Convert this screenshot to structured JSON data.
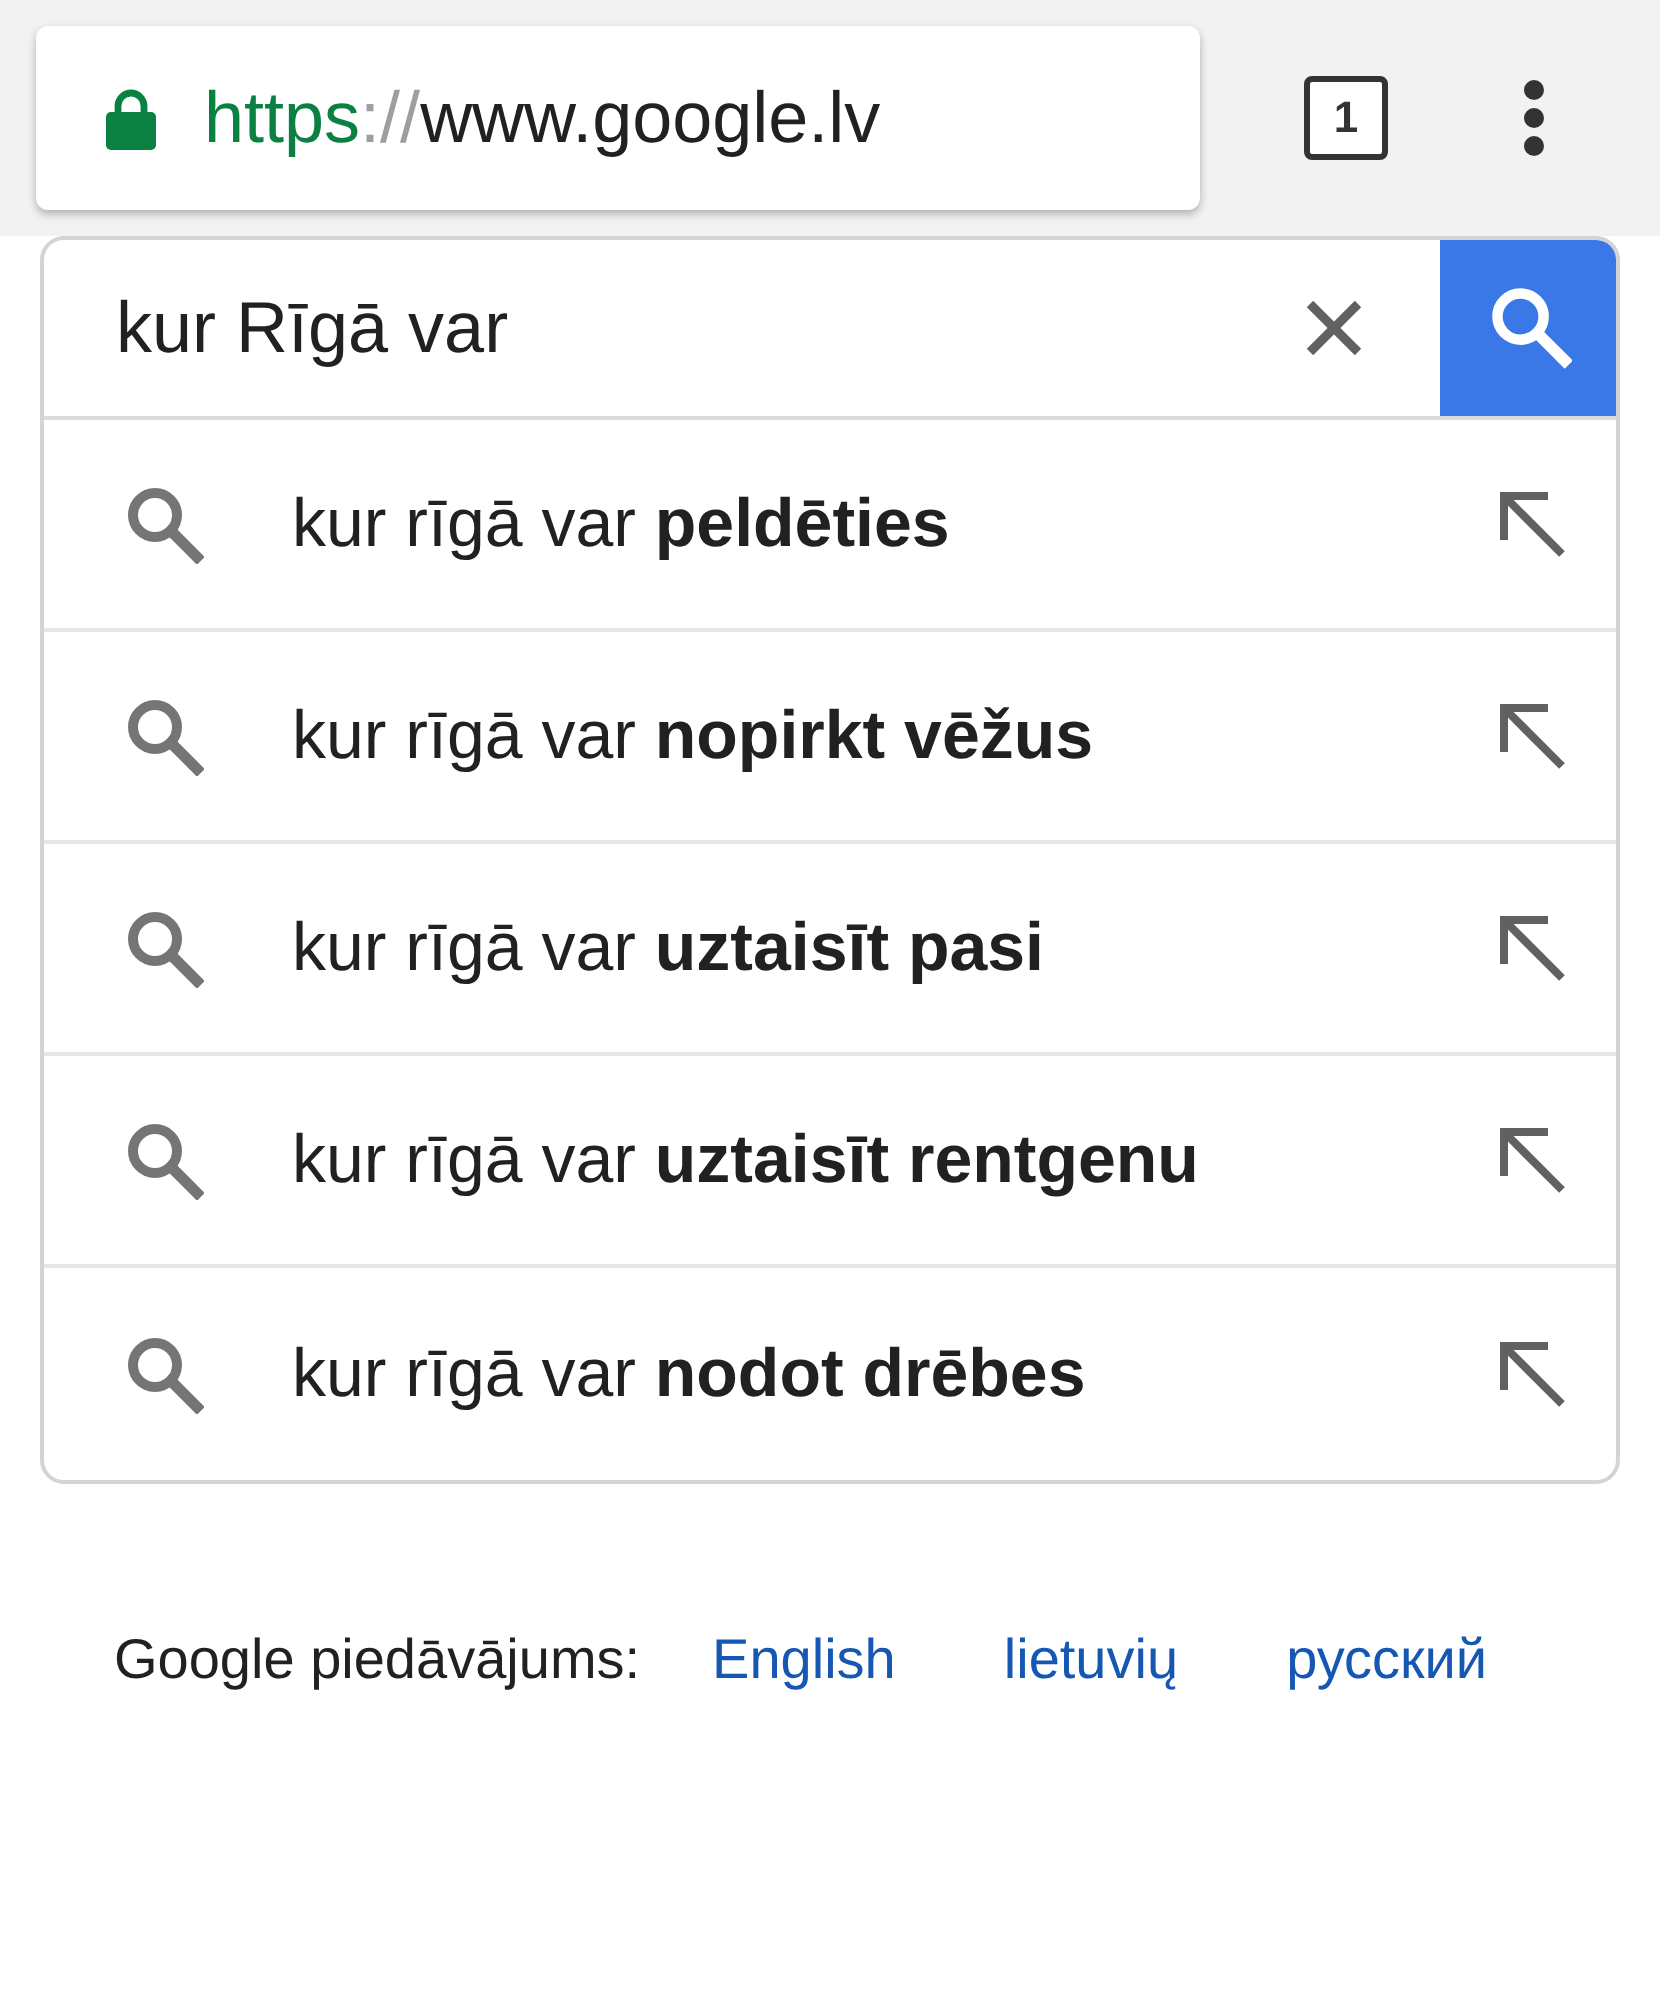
{
  "address_bar": {
    "secure": true,
    "scheme": "https",
    "separator": "://",
    "host": "www.google.lv"
  },
  "tab_count": "1",
  "search": {
    "query": "kur Rīgā var"
  },
  "suggestions": [
    {
      "text": "kur rīgā var **peldēties**"
    },
    {
      "text": "kur rīgā var **nopirkt vēžus**"
    },
    {
      "text": "kur rīgā var **uztaisīt pasi**"
    },
    {
      "text": "kur rīgā var **uztaisīt rentgenu**"
    },
    {
      "text": "kur rīgā var **nodot drēbes**"
    }
  ],
  "footer": {
    "label": "Google piedāvājums:",
    "languages": [
      "English",
      "lietuvių",
      "русский"
    ]
  }
}
